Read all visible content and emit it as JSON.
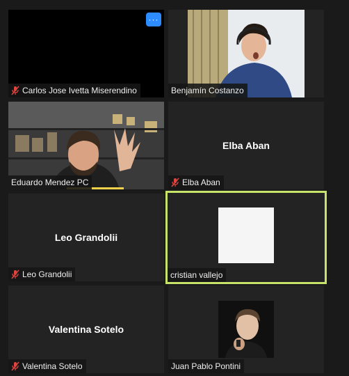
{
  "participants": [
    {
      "name": "Carlos Jose Ivetta Miserendino",
      "muted": true,
      "video": "off-black"
    },
    {
      "name": "Benjamín Costanzo",
      "muted": false,
      "video": "on"
    },
    {
      "name": "Eduardo Mendez PC",
      "muted": false,
      "video": "on"
    },
    {
      "name": "Elba Aban",
      "muted": true,
      "video": "off"
    },
    {
      "name": "Leo Grandolii",
      "muted": true,
      "video": "off"
    },
    {
      "name": "cristian vallejo",
      "muted": false,
      "video": "on",
      "active_speaker": true
    },
    {
      "name": "Valentina Sotelo",
      "muted": true,
      "video": "off"
    },
    {
      "name": "Juan Pablo Pontini",
      "muted": false,
      "video": "on"
    }
  ],
  "more_button": {
    "label": "···",
    "color": "#2d8cff"
  },
  "colors": {
    "active_border": "#c7e36a",
    "mute_icon": "#e0443e",
    "tile_bg": "#232323"
  }
}
